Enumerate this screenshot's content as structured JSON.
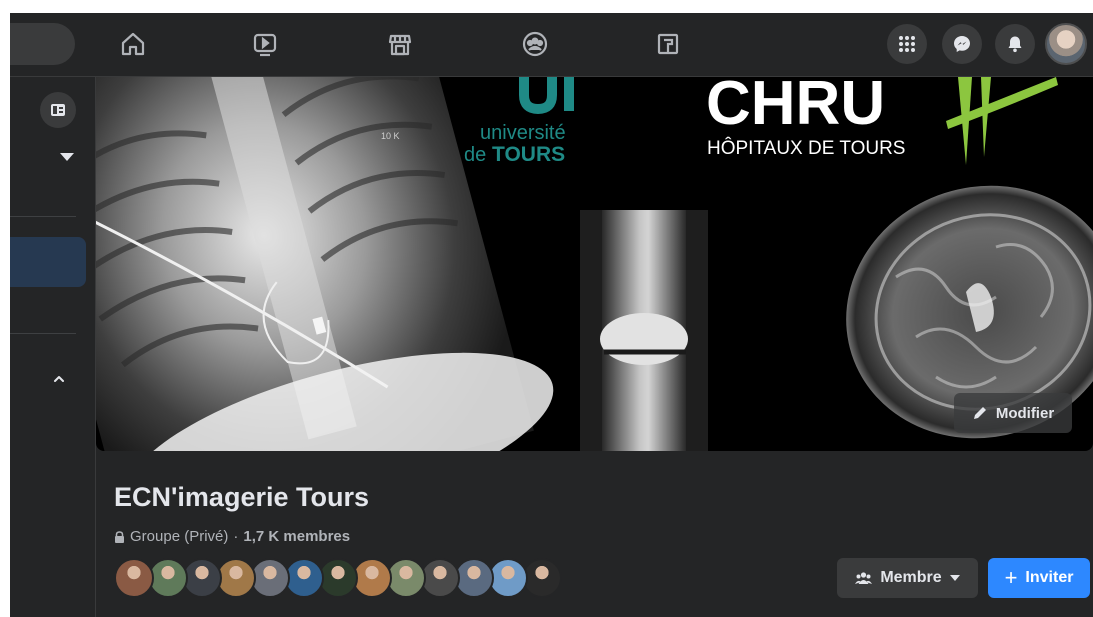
{
  "topbar": {
    "nav_icons": [
      "home-icon",
      "watch-icon",
      "marketplace-icon",
      "groups-icon",
      "gaming-icon"
    ],
    "right_icons": [
      "menu-grid-icon",
      "messenger-icon",
      "notifications-icon"
    ]
  },
  "cover": {
    "logo_university_line1": "université",
    "logo_university_de": "de",
    "logo_university_line2": "TOURS",
    "logo_chru": "CHRU",
    "logo_chru_sub": "HÔPITAUX DE TOURS",
    "xray_marker": "10 K",
    "modify_label": "Modifier"
  },
  "group": {
    "title": "ECN'imagerie Tours",
    "privacy": "Groupe (Privé)",
    "separator": "·",
    "members_count": "1,7 K membres",
    "member_avatars": [
      "#8a5a44",
      "#5f7a5a",
      "#3b3f46",
      "#a07848",
      "#6a6e78",
      "#2f5f8e",
      "#2b3a2b",
      "#b07a4a",
      "#7a8a6a",
      "#4a4a4a",
      "#5a6a80",
      "#6f9bc7",
      "#2a2a2a"
    ]
  },
  "actions": {
    "member_label": "Membre",
    "invite_label": "Inviter",
    "invite_plus": "+"
  },
  "colors": {
    "accent": "#2d88ff",
    "surface": "#242526",
    "button": "#3a3b3c"
  }
}
